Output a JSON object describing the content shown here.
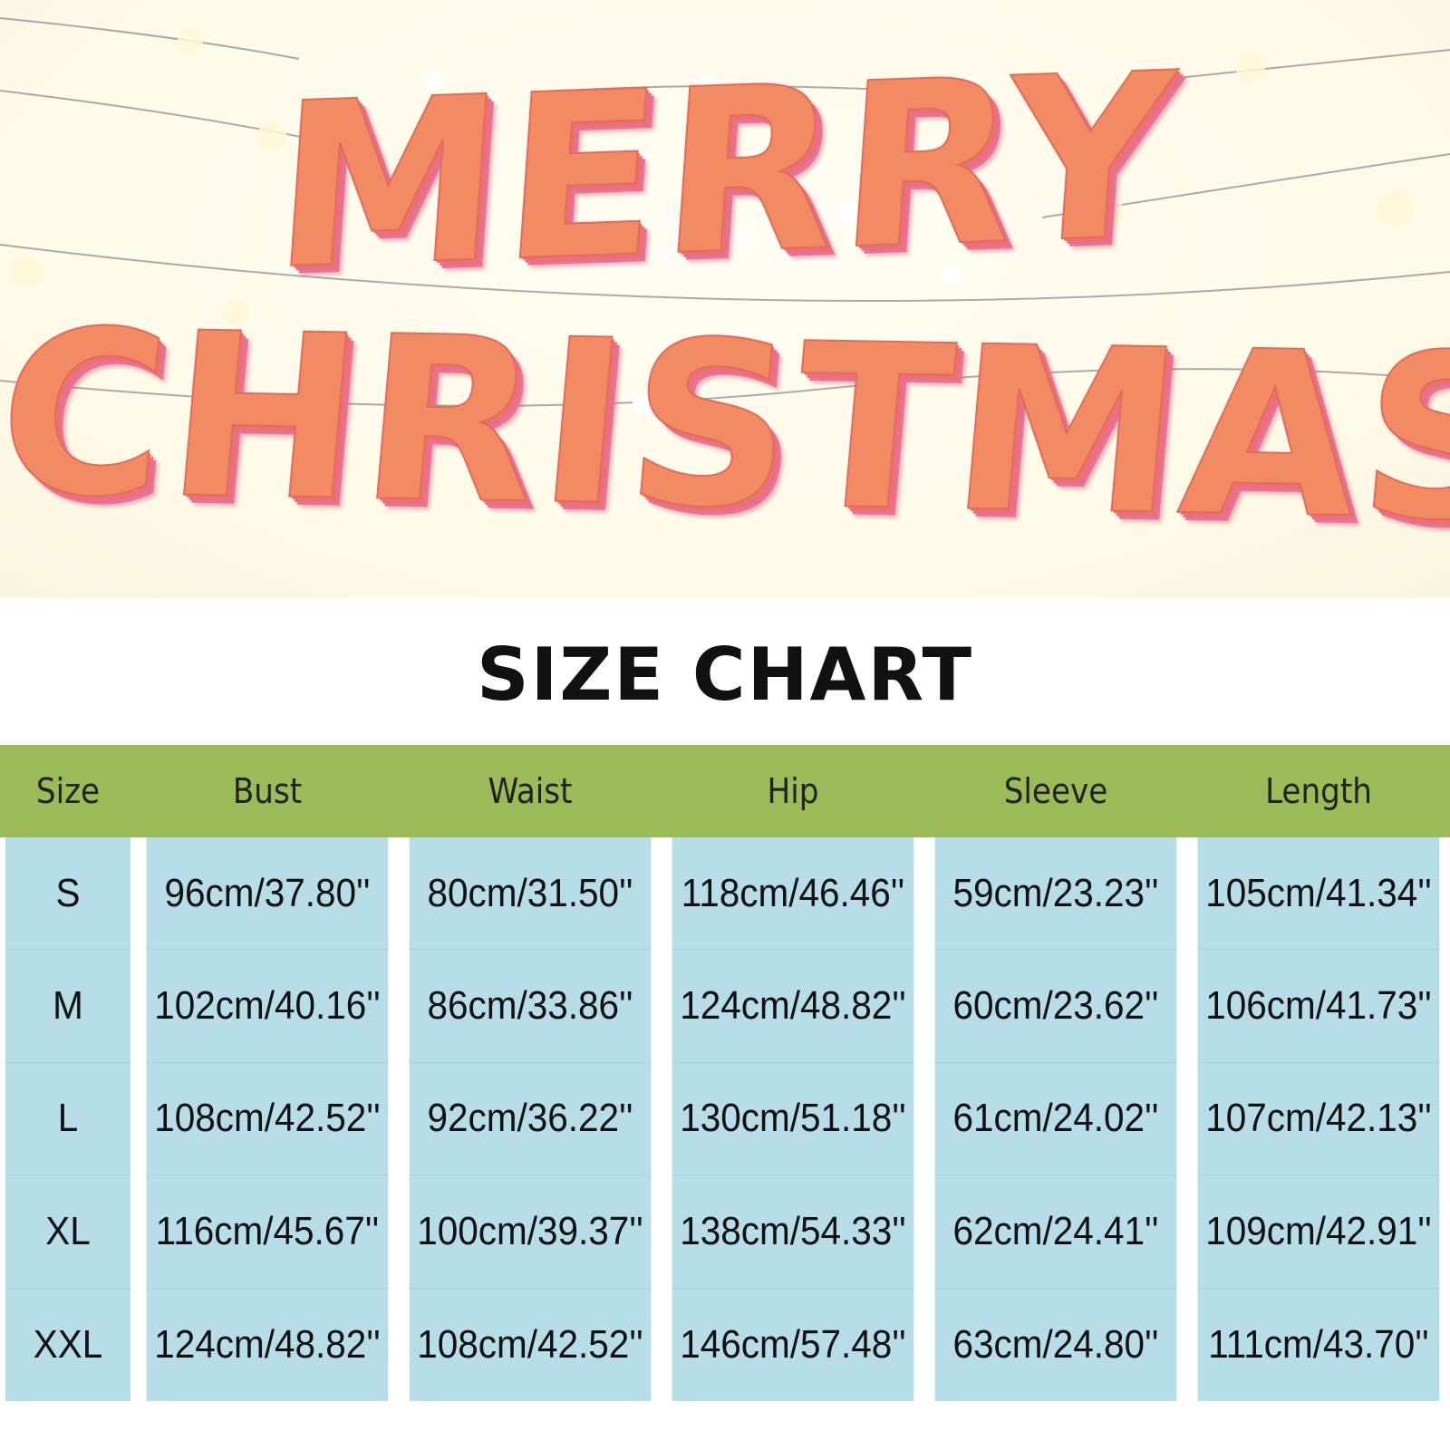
{
  "banner": {
    "line1": "MERRY",
    "line2": "CHRISTMAS"
  },
  "title": "SIZE CHART",
  "table": {
    "headers": [
      "Size",
      "Bust",
      "Waist",
      "Hip",
      "Sleeve",
      "Length"
    ],
    "rows": [
      [
        "S",
        "96cm/37.80''",
        "80cm/31.50''",
        "118cm/46.46''",
        "59cm/23.23''",
        "105cm/41.34''"
      ],
      [
        "M",
        "102cm/40.16''",
        "86cm/33.86''",
        "124cm/48.82''",
        "60cm/23.62''",
        "106cm/41.73''"
      ],
      [
        "L",
        "108cm/42.52''",
        "92cm/36.22''",
        "130cm/51.18''",
        "61cm/24.02''",
        "107cm/42.13''"
      ],
      [
        "XL",
        "116cm/45.67''",
        "100cm/39.37''",
        "138cm/54.33''",
        "62cm/24.41''",
        "109cm/42.91''"
      ],
      [
        "XXL",
        "124cm/48.82''",
        "108cm/42.52''",
        "146cm/57.48''",
        "63cm/24.80''",
        "111cm/43.70''"
      ]
    ]
  },
  "colors": {
    "header_bg": "#9bbb59",
    "body_bg": "#b6dde8",
    "banner_text": "#f28a63"
  }
}
